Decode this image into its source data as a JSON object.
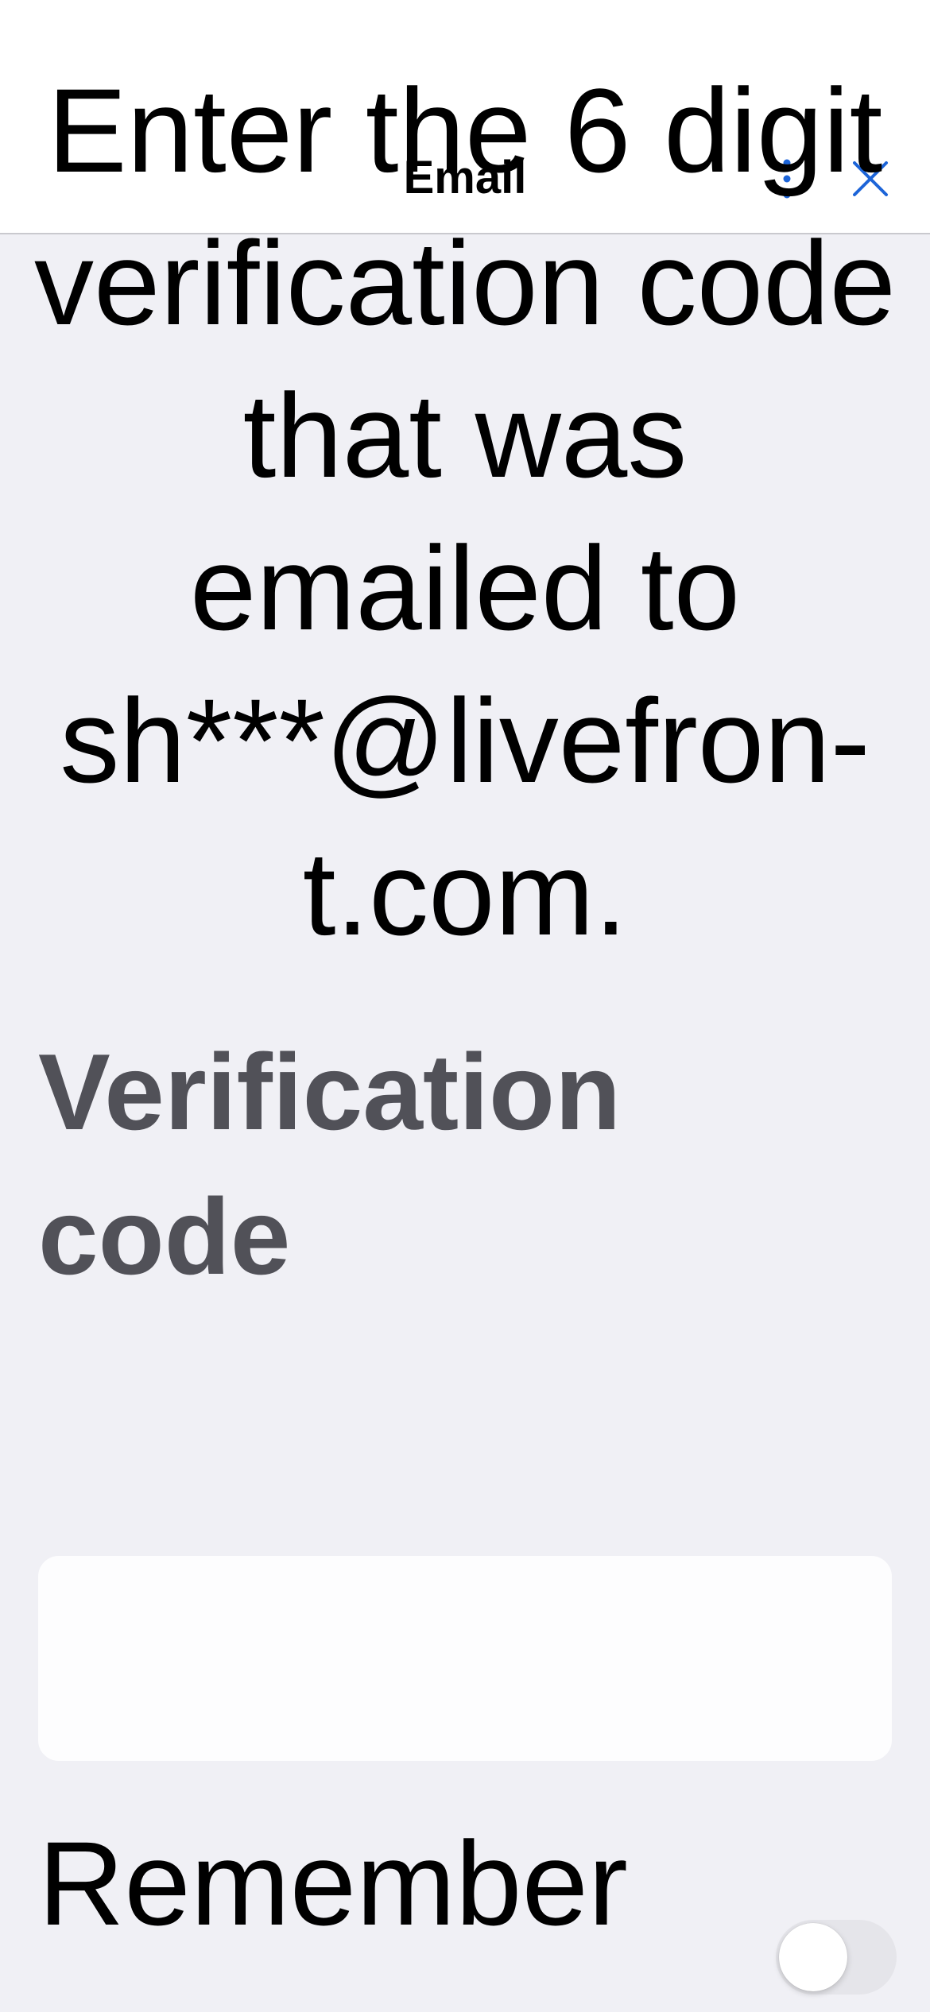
{
  "header": {
    "title": "Email",
    "more_icon": "vertical-ellipsis-icon",
    "close_icon": "close-icon",
    "accent_color": "#1c64d8"
  },
  "main": {
    "instruction": "Enter the 6 digit verification code that was emailed to sh***@livefron-t.com.",
    "code_label": "Verification code",
    "code_input": {
      "value": "",
      "placeholder": ""
    },
    "remember_label": "Remember",
    "remember_toggle": {
      "on": false
    }
  },
  "colors": {
    "background": "#f0f0f5",
    "label_gray": "#515158",
    "toggle_off": "#e5e5ea"
  }
}
